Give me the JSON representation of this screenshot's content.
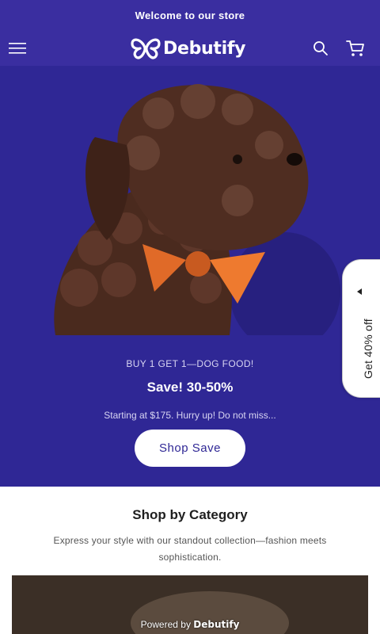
{
  "announcement": {
    "text": "Welcome to our store"
  },
  "header": {
    "brand": "Debutify",
    "menu_icon": "menu-icon",
    "search_icon": "search-icon",
    "cart_icon": "cart-icon"
  },
  "hero": {
    "image_subject": "dog"
  },
  "promo": {
    "kicker": "BUY 1 GET 1—DOG FOOD!",
    "title": "Save! 30-50%",
    "subtitle": "Starting at $175. Hurry up! Do not miss...",
    "button_label": "Shop Save"
  },
  "side_tab": {
    "label": "Get 40% off"
  },
  "category": {
    "title": "Shop by Category",
    "description": "Express your style with our standout collection—fashion meets sophistication."
  },
  "footer_badge": {
    "prefix": "Powered by",
    "brand": "Debutify"
  },
  "colors": {
    "brand_bg": "#3a2ea0",
    "hero_bg": "#2f2795",
    "accent": "#e8692a"
  }
}
